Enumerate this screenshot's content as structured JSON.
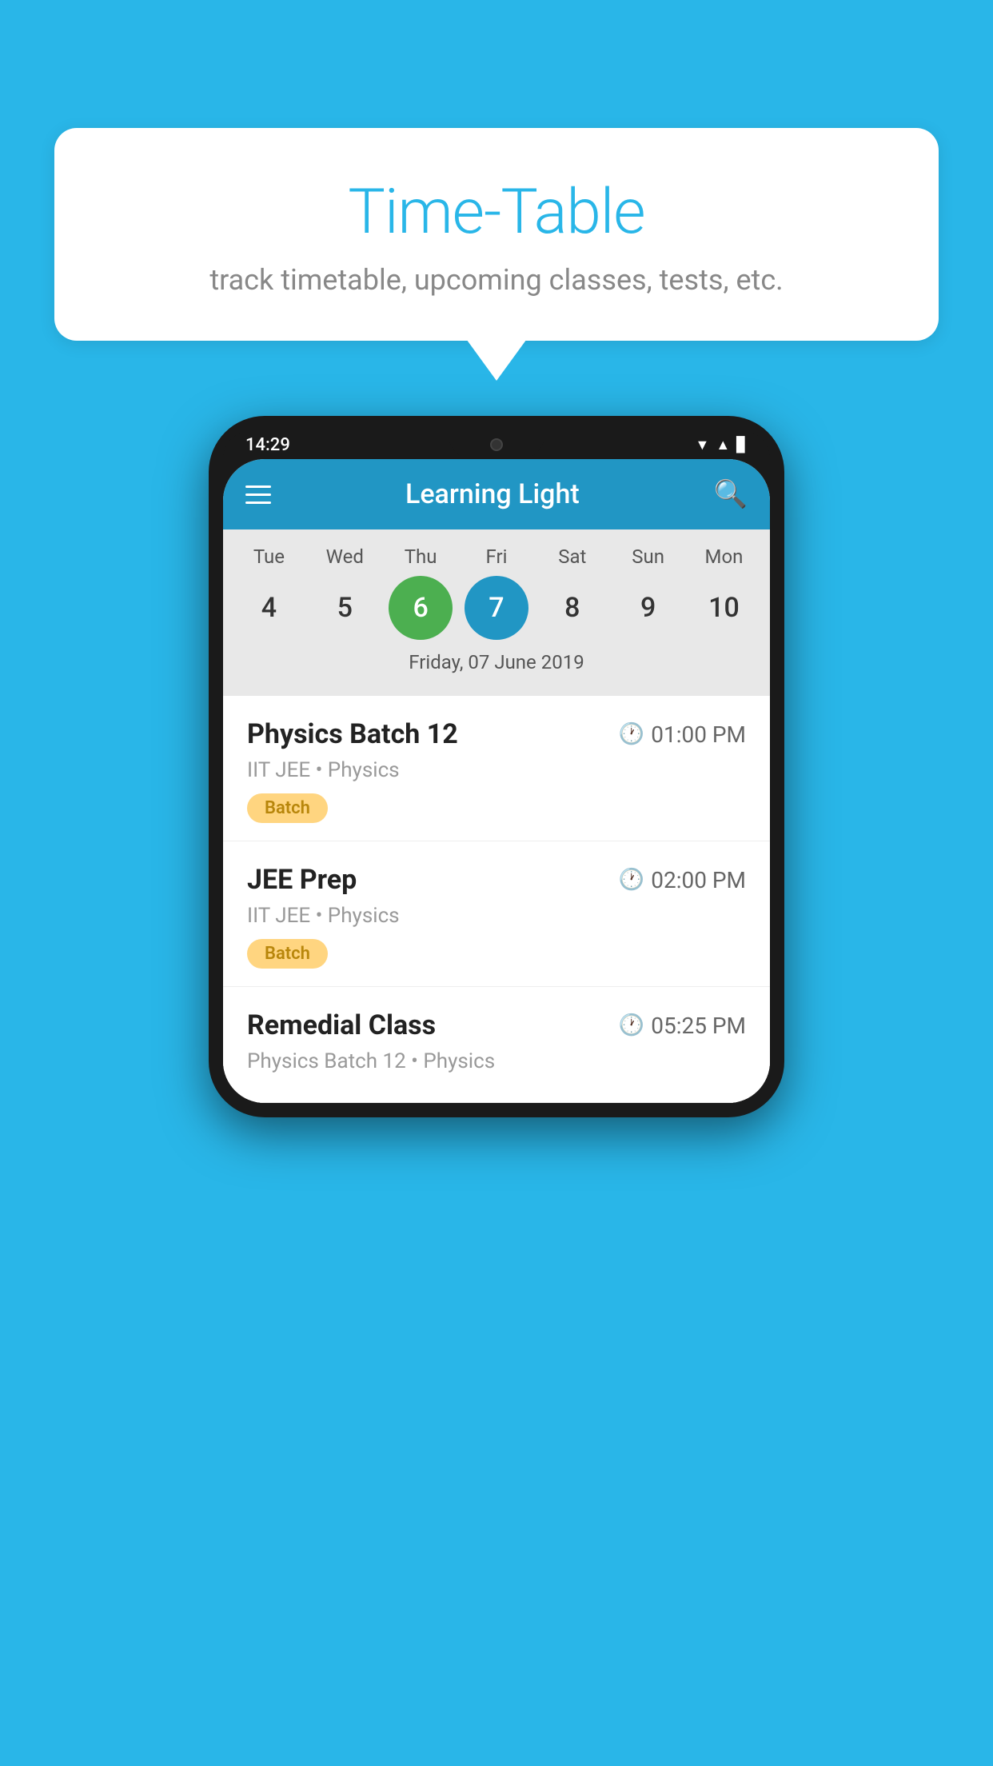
{
  "background_color": "#29b6e8",
  "speech_bubble": {
    "title": "Time-Table",
    "subtitle": "track timetable, upcoming classes, tests, etc."
  },
  "phone": {
    "status_bar": {
      "time": "14:29"
    },
    "app_header": {
      "title": "Learning Light"
    },
    "calendar": {
      "days": [
        {
          "label": "Tue",
          "num": "4"
        },
        {
          "label": "Wed",
          "num": "5"
        },
        {
          "label": "Thu",
          "num": "6",
          "state": "today"
        },
        {
          "label": "Fri",
          "num": "7",
          "state": "selected"
        },
        {
          "label": "Sat",
          "num": "8"
        },
        {
          "label": "Sun",
          "num": "9"
        },
        {
          "label": "Mon",
          "num": "10"
        }
      ],
      "selected_date_label": "Friday, 07 June 2019"
    },
    "schedule": [
      {
        "title": "Physics Batch 12",
        "time": "01:00 PM",
        "sub": "IIT JEE • Physics",
        "badge": "Batch"
      },
      {
        "title": "JEE Prep",
        "time": "02:00 PM",
        "sub": "IIT JEE • Physics",
        "badge": "Batch"
      },
      {
        "title": "Remedial Class",
        "time": "05:25 PM",
        "sub": "Physics Batch 12 • Physics",
        "badge": ""
      }
    ]
  }
}
